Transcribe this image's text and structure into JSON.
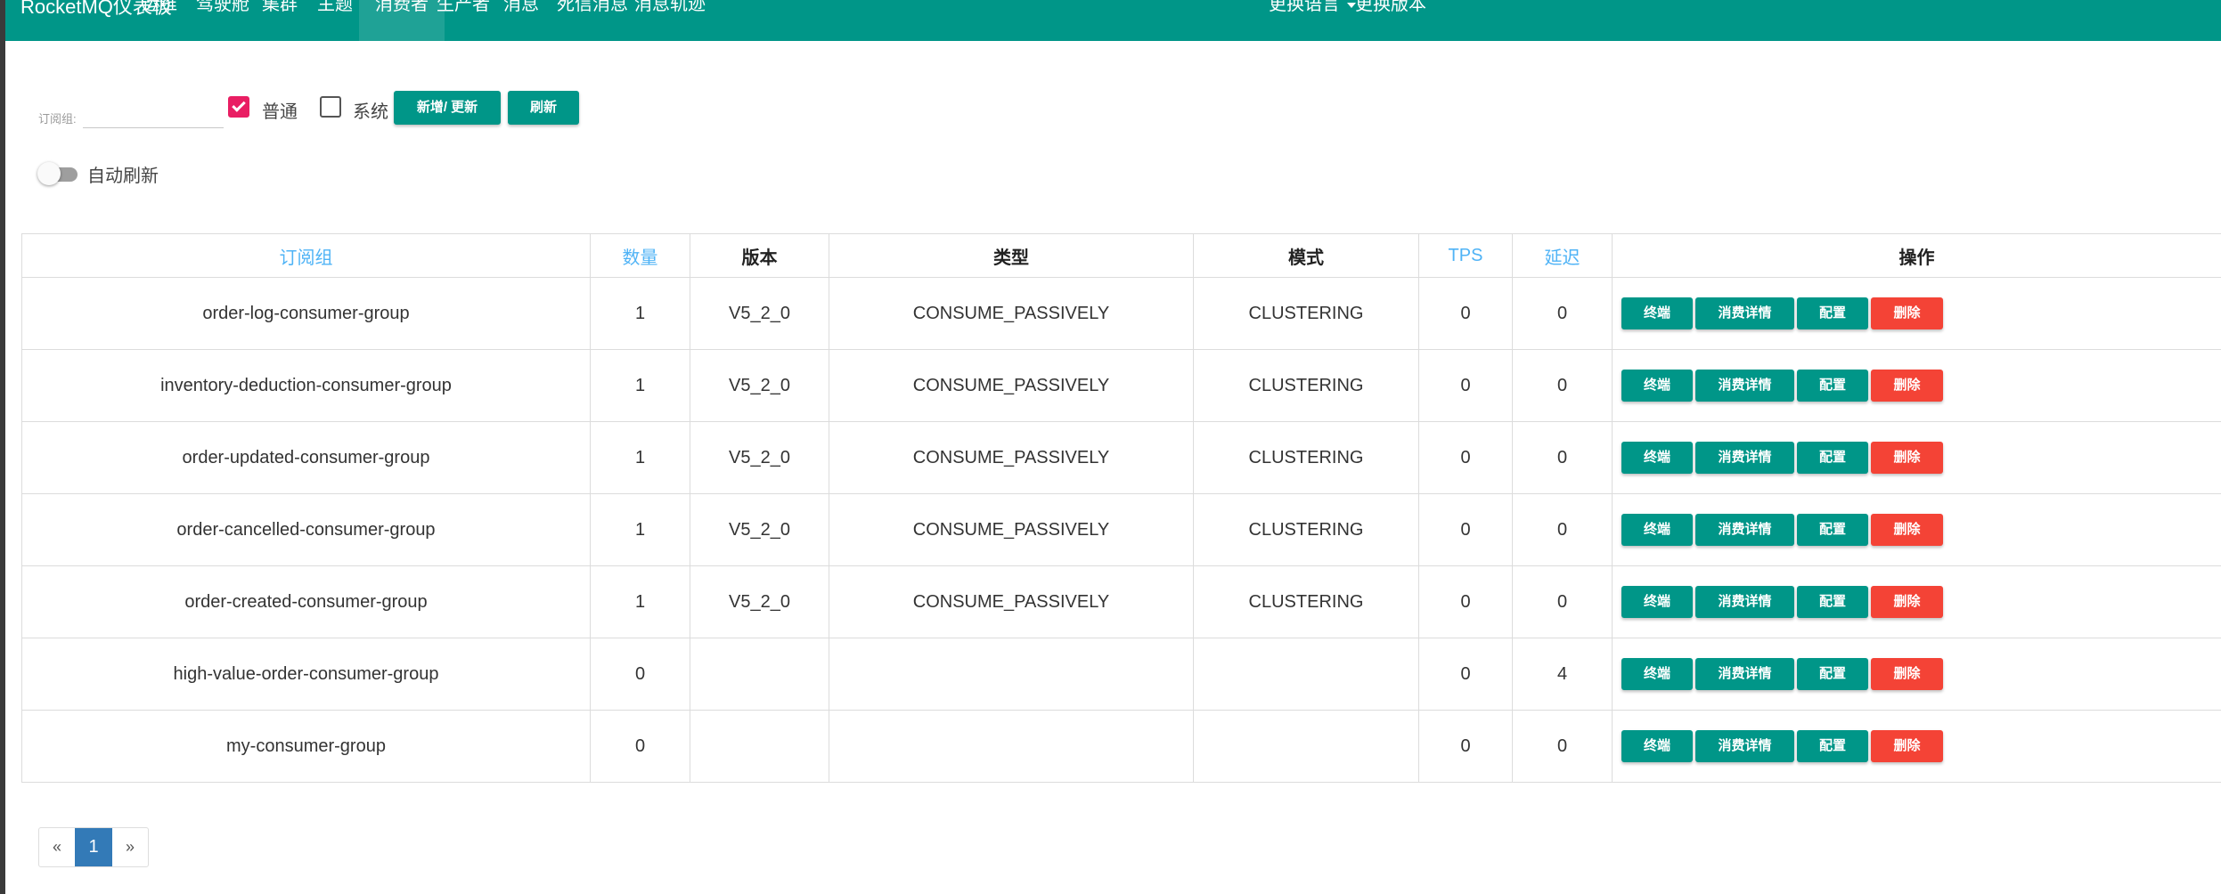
{
  "navbar": {
    "brand": "RocketMQ仪表板",
    "items": [
      "运维",
      "驾驶舱",
      "集群",
      "主题",
      "消费者",
      "生产者",
      "消息",
      "死信消息",
      "消息轨迹"
    ],
    "active_index": 4,
    "language_menu": "更换语言",
    "version_menu": "更换版本",
    "colors": {
      "bar": "#009688"
    }
  },
  "filter": {
    "subscription_label": "订阅组:",
    "subscription_value": "",
    "normal_label": "普通",
    "normal_checked": true,
    "system_label": "系统",
    "system_checked": false,
    "add_update_button": "新增/ 更新",
    "refresh_button": "刷新",
    "auto_refresh_label": "自动刷新",
    "auto_refresh_on": false
  },
  "table": {
    "headers": {
      "group": "订阅组",
      "count": "数量",
      "version": "版本",
      "type": "类型",
      "mode": "模式",
      "tps": "TPS",
      "delay": "延迟",
      "ops": "操作"
    },
    "rows": [
      {
        "group": "order-log-consumer-group",
        "count": "1",
        "version": "V5_2_0",
        "type": "CONSUME_PASSIVELY",
        "mode": "CLUSTERING",
        "tps": "0",
        "delay": "0"
      },
      {
        "group": "inventory-deduction-consumer-group",
        "count": "1",
        "version": "V5_2_0",
        "type": "CONSUME_PASSIVELY",
        "mode": "CLUSTERING",
        "tps": "0",
        "delay": "0"
      },
      {
        "group": "order-updated-consumer-group",
        "count": "1",
        "version": "V5_2_0",
        "type": "CONSUME_PASSIVELY",
        "mode": "CLUSTERING",
        "tps": "0",
        "delay": "0"
      },
      {
        "group": "order-cancelled-consumer-group",
        "count": "1",
        "version": "V5_2_0",
        "type": "CONSUME_PASSIVELY",
        "mode": "CLUSTERING",
        "tps": "0",
        "delay": "0"
      },
      {
        "group": "order-created-consumer-group",
        "count": "1",
        "version": "V5_2_0",
        "type": "CONSUME_PASSIVELY",
        "mode": "CLUSTERING",
        "tps": "0",
        "delay": "0"
      },
      {
        "group": "high-value-order-consumer-group",
        "count": "0",
        "version": "",
        "type": "",
        "mode": "",
        "tps": "0",
        "delay": "4"
      },
      {
        "group": "my-consumer-group",
        "count": "0",
        "version": "",
        "type": "",
        "mode": "",
        "tps": "0",
        "delay": "0"
      }
    ],
    "actions": {
      "client": "终端",
      "detail": "消费详情",
      "config": "配置",
      "delete": "删除"
    }
  },
  "pagination": {
    "prev": "«",
    "current": "1",
    "next": "»"
  }
}
